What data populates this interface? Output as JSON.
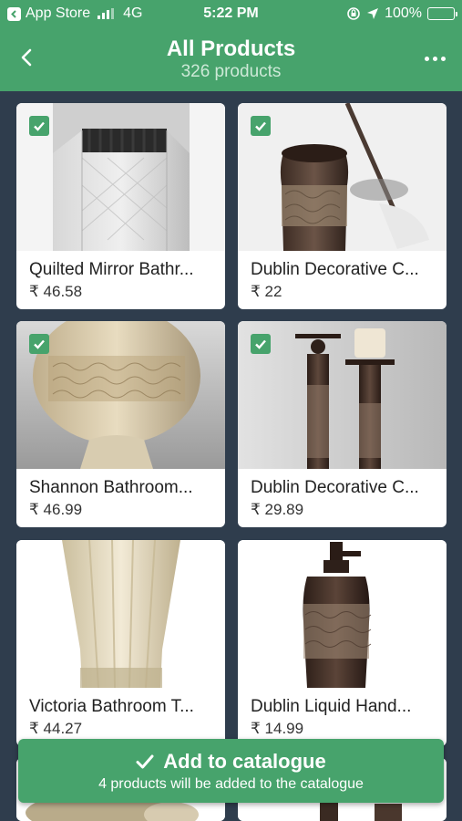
{
  "status_bar": {
    "back_app": "App Store",
    "network": "4G",
    "time": "5:22 PM",
    "battery": "100%"
  },
  "header": {
    "title": "All Products",
    "subtitle": "326 products"
  },
  "products": [
    {
      "name": "Quilted Mirror Bathr...",
      "price": "₹ 46.58",
      "selected": true
    },
    {
      "name": "Dublin Decorative C...",
      "price": "₹ 22",
      "selected": true
    },
    {
      "name": "Shannon Bathroom...",
      "price": "₹ 46.99",
      "selected": true
    },
    {
      "name": "Dublin Decorative C...",
      "price": "₹ 29.89",
      "selected": true
    },
    {
      "name": "Victoria Bathroom T...",
      "price": "₹ 44.27",
      "selected": false
    },
    {
      "name": "Dublin Liquid Hand...",
      "price": "₹ 14.99",
      "selected": false
    }
  ],
  "cta": {
    "label": "Add to catalogue",
    "subtext": "4 products will be added to the catalogue"
  },
  "colors": {
    "primary": "#47a36c",
    "background": "#2f3d4d"
  }
}
